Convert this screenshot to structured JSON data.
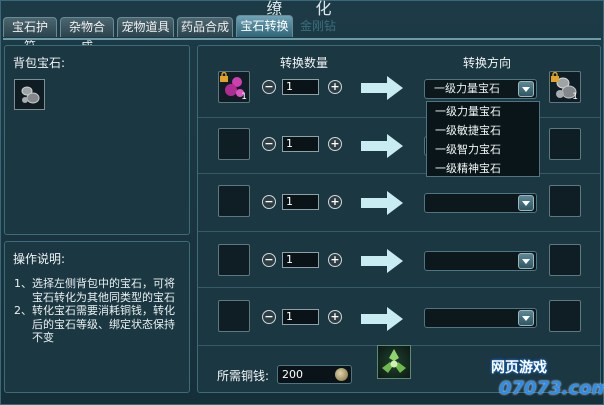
{
  "window": {
    "title_fragment": "缭 化"
  },
  "tabs": [
    {
      "label": "宝石护符",
      "active": false
    },
    {
      "label": "杂物合成",
      "active": false
    },
    {
      "label": "宠物道具",
      "active": false
    },
    {
      "label": "药品合成",
      "active": false
    },
    {
      "label": "宝石转换",
      "active": true
    },
    {
      "label": "金刚钻",
      "active": false
    }
  ],
  "bag": {
    "title": "背包宝石:"
  },
  "instructions": {
    "title": "操作说明:",
    "items": [
      {
        "num": "1、",
        "text": "选择左侧背包中的宝石，可将宝石转化为其他同类型的宝石"
      },
      {
        "num": "2、",
        "text": "转化宝石需要消耗铜钱，转化后的宝石等级、绑定状态保持不变"
      }
    ]
  },
  "convert": {
    "qty_header": "转换数量",
    "dir_header": "转换方向",
    "rows": [
      {
        "source_count": "1",
        "qty": "1",
        "direction": "一级力量宝石",
        "target_count": "1"
      },
      {
        "source_count": "",
        "qty": "1",
        "direction": "",
        "target_count": ""
      },
      {
        "source_count": "",
        "qty": "1",
        "direction": "",
        "target_count": ""
      },
      {
        "source_count": "",
        "qty": "1",
        "direction": "",
        "target_count": ""
      },
      {
        "source_count": "",
        "qty": "1",
        "direction": "",
        "target_count": ""
      }
    ],
    "minus_glyph": "−",
    "plus_glyph": "+",
    "dropdown_options": [
      "一级力量宝石",
      "一级敏捷宝石",
      "一级智力宝石",
      "一级精神宝石"
    ]
  },
  "cost": {
    "label": "所需铜钱:",
    "value": "200"
  },
  "watermark": {
    "line1": "网页游戏",
    "line2": "07073.com"
  },
  "colors": {
    "arrow": "#bfe6ef",
    "gem": "#c43ca0",
    "accent": "#2e6577"
  }
}
